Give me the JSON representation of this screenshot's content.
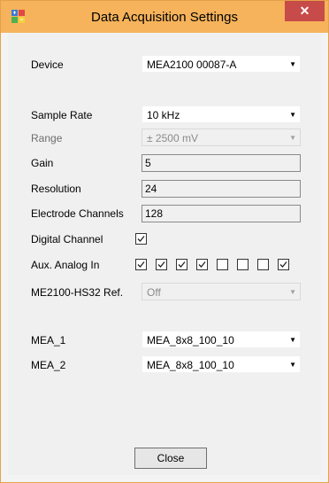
{
  "window": {
    "title": "Data Acquisition Settings",
    "close_glyph": "✕"
  },
  "device": {
    "label": "Device",
    "value": "MEA2100 00087-A"
  },
  "sample_rate": {
    "label": "Sample Rate",
    "value": "10 kHz"
  },
  "range": {
    "label": "Range",
    "value": "± 2500 mV"
  },
  "gain": {
    "label": "Gain",
    "value": "5"
  },
  "resolution": {
    "label": "Resolution",
    "value": "24"
  },
  "electrode_channels": {
    "label": "Electrode Channels",
    "value": "128"
  },
  "digital_channel": {
    "label": "Digital Channel",
    "checked": true
  },
  "aux_analog": {
    "label": "Aux. Analog In",
    "checked": [
      true,
      true,
      true,
      true,
      false,
      false,
      false,
      true
    ]
  },
  "hs32_ref": {
    "label": "ME2100-HS32 Ref.",
    "value": "Off"
  },
  "mea1": {
    "label": "MEA_1",
    "value": "MEA_8x8_100_10"
  },
  "mea2": {
    "label": "MEA_2",
    "value": "MEA_8x8_100_10"
  },
  "buttons": {
    "close": "Close"
  },
  "icons": {
    "dropdown": "▼"
  }
}
